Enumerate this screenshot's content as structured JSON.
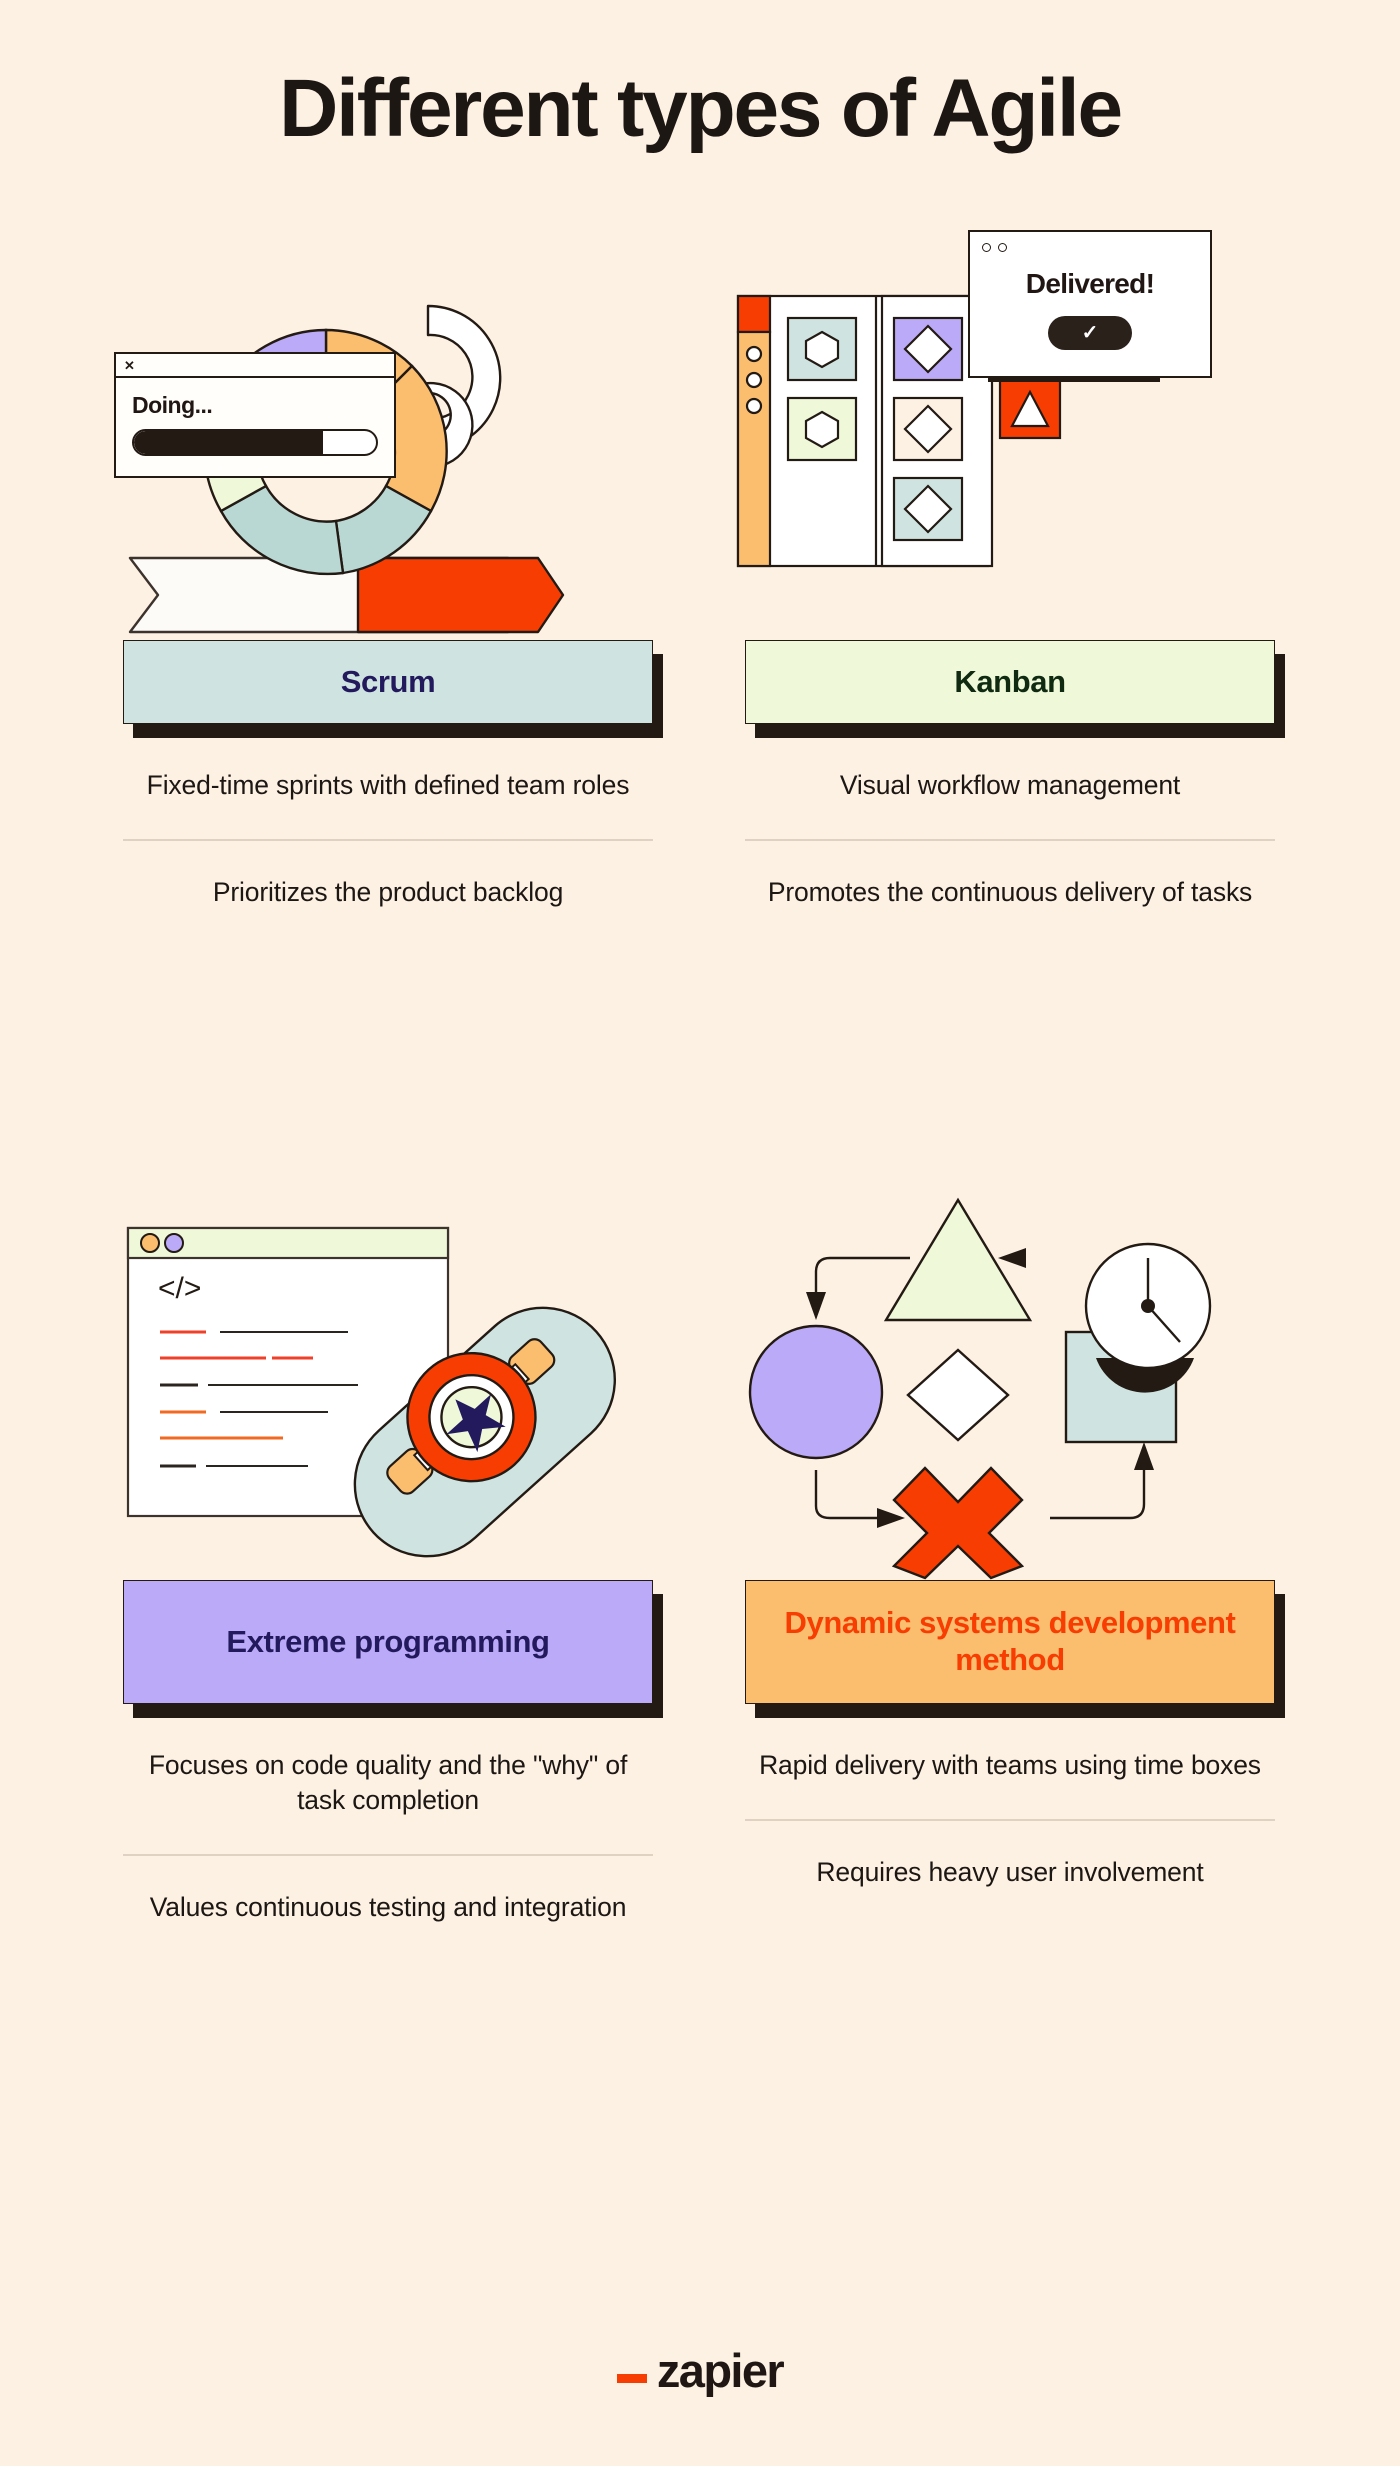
{
  "page": {
    "title": "Different types of Agile",
    "background_color": "#fdf1e3"
  },
  "palette": {
    "cream": "#fdf1e3",
    "ink": "#231a14",
    "orange_red": "#f83d02",
    "orange_light": "#fbbd6e",
    "purple": "#bbaaf7",
    "mint": "#cfe4e1",
    "lime": "#eff8d9",
    "navy_text": "#231a5e",
    "green_text": "#0f2a10"
  },
  "cards": [
    {
      "id": "scrum",
      "label": "Scrum",
      "label_bg": "#cfe4e1",
      "label_text_color": "#231a5e",
      "points": [
        "Fixed-time sprints with defined team roles",
        "Prioritizes the product backlog"
      ],
      "illustration": {
        "name": "scrum-donut-illustration",
        "window_title": "Doing...",
        "window_close_glyph": "✕",
        "progress_percent": 78,
        "donut_segments": [
          "#bbaaf7",
          "#fbbd6e",
          "#b9d8d4",
          "#f83d02",
          "#eff8d9",
          "#231a14"
        ]
      }
    },
    {
      "id": "kanban",
      "label": "Kanban",
      "label_bg": "#eff8d9",
      "label_text_color": "#0f2a10",
      "points": [
        "Visual workflow management",
        "Promotes the continuous delivery of tasks"
      ],
      "illustration": {
        "name": "kanban-board-illustration",
        "popup_title": "Delivered!",
        "popup_button_glyph": "✓",
        "sidebar_top_color": "#f83d02",
        "sidebar_color": "#fbbd6e",
        "sidebar_dots": 3,
        "cards": [
          {
            "fill": "#cfe4e1",
            "shape": "hexagon"
          },
          {
            "fill": "#eff8d9",
            "shape": "hexagon"
          },
          {
            "fill": "#bbaaf7",
            "shape": "diamond"
          },
          {
            "fill": "#fdf1e3",
            "shape": "diamond"
          },
          {
            "fill": "#cfe4e1",
            "shape": "diamond"
          },
          {
            "fill": "#f83d02",
            "shape": "triangle"
          }
        ]
      }
    },
    {
      "id": "extreme-programming",
      "label": "Extreme programming",
      "label_bg": "#bbaaf7",
      "label_text_color": "#231a5e",
      "points": [
        "Focuses on code quality and the \"why\" of task completion",
        "Values continuous testing and integration"
      ],
      "illustration": {
        "name": "code-window-skateboard-illustration",
        "code_glyph": "</>",
        "titlebar_dots": [
          "#fbbd6e",
          "#bbaaf7"
        ],
        "code_line_colors": [
          "#f03f2a",
          "#2b2520",
          "#f03f2a",
          "#2b2520",
          "#2b2520",
          "#f26a22",
          "#f26a22",
          "#2b2520"
        ],
        "skateboard": {
          "deck_color": "#cfe4e1",
          "truck_color": "#fbbd6e",
          "ring_color": "#f83d02",
          "center_color": "#eff8d9",
          "star_color": "#231a5e"
        }
      }
    },
    {
      "id": "dsdm",
      "label": "Dynamic systems development method",
      "label_bg": "#fbbd6e",
      "label_text_color": "#f83d02",
      "points": [
        "Rapid delivery with teams using time boxes",
        "Requires heavy user involvement"
      ],
      "illustration": {
        "name": "shapes-cycle-illustration",
        "shapes": [
          {
            "shape": "triangle",
            "fill": "#eff8d9"
          },
          {
            "shape": "circle",
            "fill": "#bbaaf7"
          },
          {
            "shape": "diamond",
            "fill": "#ffffff"
          },
          {
            "shape": "square",
            "fill": "#cfe4e1"
          },
          {
            "shape": "cross",
            "fill": "#f83d02"
          },
          {
            "shape": "clock",
            "fill": "#ffffff"
          }
        ],
        "arrow_count": 4
      }
    }
  ],
  "footer": {
    "logo_text": "zapier",
    "logo_dash_color": "#f83d02",
    "logo_text_color": "#201613"
  }
}
